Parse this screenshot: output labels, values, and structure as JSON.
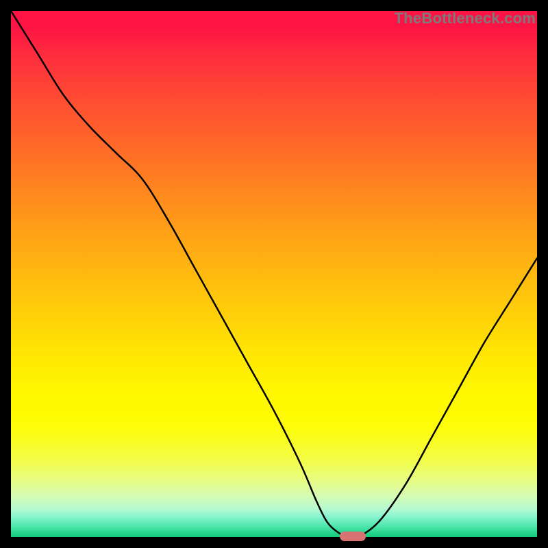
{
  "watermark": "TheBottleneck.com",
  "colors": {
    "frame": "#000000",
    "curve": "#000000",
    "marker": "#d97373",
    "gradient_top": "#fd1444",
    "gradient_bottom": "#14cb7c"
  },
  "chart_data": {
    "type": "line",
    "title": "",
    "xlabel": "",
    "ylabel": "",
    "xlim": [
      0,
      100
    ],
    "ylim": [
      0,
      100
    ],
    "grid": false,
    "legend": false,
    "series": [
      {
        "name": "bottleneck-curve",
        "x": [
          0,
          5,
          10,
          15,
          20,
          25,
          30,
          35,
          40,
          45,
          50,
          55,
          58,
          60,
          62,
          64,
          66,
          70,
          75,
          80,
          85,
          90,
          95,
          100
        ],
        "y": [
          100,
          92,
          84,
          78,
          73,
          68,
          60,
          51,
          42,
          33,
          24,
          14,
          7,
          3,
          1,
          0,
          0,
          3,
          10,
          19,
          28,
          37,
          45,
          53
        ]
      }
    ],
    "marker": {
      "x_center": 65,
      "width_pct": 5,
      "y": 0
    },
    "annotations": []
  }
}
